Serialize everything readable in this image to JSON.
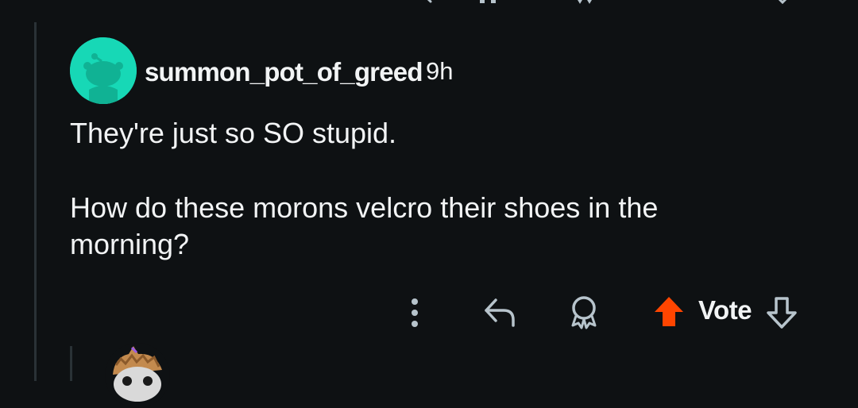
{
  "comment": {
    "username": "summon_pot_of_greed",
    "time": "9h",
    "paragraphs": [
      "They're just so SO stupid.",
      "How do these morons velcro their shoes in the morning?"
    ],
    "avatar_color": "#17d8b6"
  },
  "actions": {
    "more_icon": "more-vertical-icon",
    "reply_icon": "reply-icon",
    "award_icon": "award-icon",
    "upvote_icon": "upvote-icon",
    "downvote_icon": "downvote-icon",
    "vote_label": "Vote",
    "upvote_color": "#ff4500"
  },
  "colors": {
    "background": "#0e1113",
    "text": "#f2f4f5",
    "icon": "#b7c4cc",
    "thread_line": "#2a3236"
  }
}
